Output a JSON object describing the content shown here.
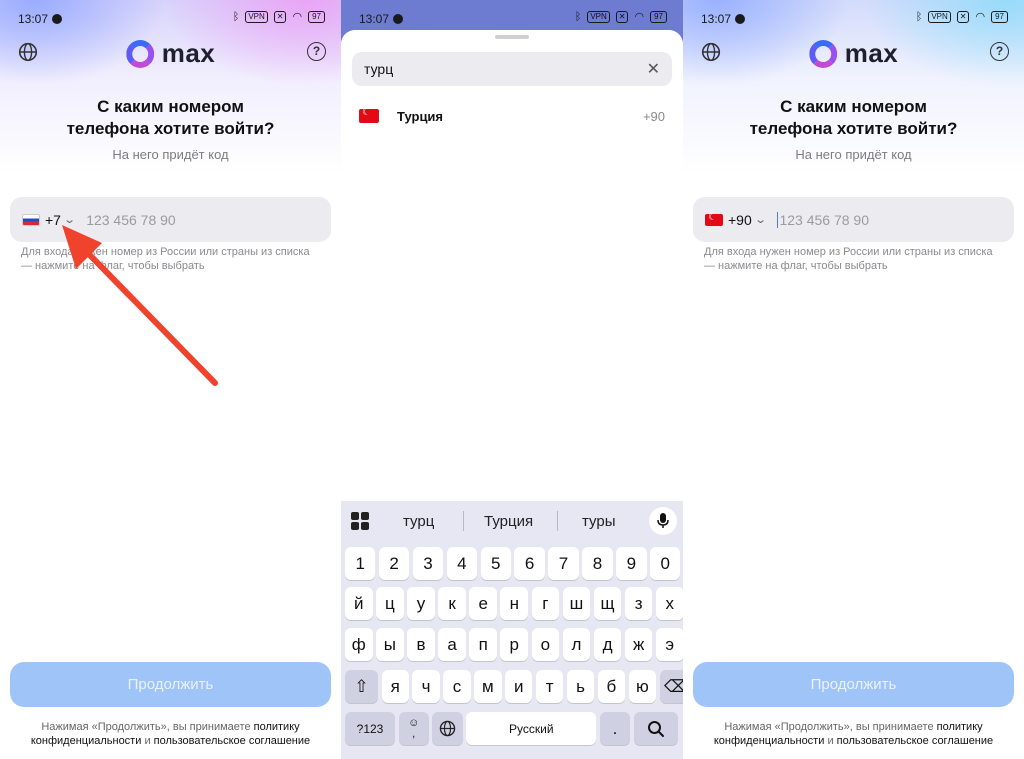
{
  "status_bar": {
    "time": "13:07",
    "vpn_label": "VPN",
    "battery_level": "97"
  },
  "app": {
    "logo_text": "max"
  },
  "login": {
    "headline_line1": "С каким номером",
    "headline_line2": "телефона хотите войти?",
    "subline": "На него придёт код",
    "phone_placeholder": "123 456 78 90",
    "hint": "Для входа нужен номер из России или страны из списка — нажмите на флаг, чтобы выбрать",
    "continue_label": "Продолжить",
    "terms_prefix": "Нажимая «Продолжить», вы принимаете",
    "terms_link1": "политику конфиденциальности",
    "terms_and": "и",
    "terms_link2": "пользовательское соглашение"
  },
  "screen1": {
    "country_code": "+7",
    "flag": "russia-flag"
  },
  "screen3": {
    "country_code": "+90",
    "flag": "turkey-flag"
  },
  "country_search": {
    "query": "турц",
    "results": [
      {
        "name": "Турция",
        "code": "+90",
        "flag": "turkey-flag"
      }
    ]
  },
  "keyboard": {
    "suggestions": [
      "турц",
      "Турция",
      "туры"
    ],
    "row_digits": [
      "1",
      "2",
      "3",
      "4",
      "5",
      "6",
      "7",
      "8",
      "9",
      "0"
    ],
    "row1": [
      "й",
      "ц",
      "у",
      "к",
      "е",
      "н",
      "г",
      "ш",
      "щ",
      "з",
      "х"
    ],
    "row2": [
      "ф",
      "ы",
      "в",
      "а",
      "п",
      "р",
      "о",
      "л",
      "д",
      "ж",
      "э"
    ],
    "row3": [
      "я",
      "ч",
      "с",
      "м",
      "и",
      "т",
      "ь",
      "б",
      "ю"
    ],
    "symbols_label": "?123",
    "comma_label": ",",
    "space_label": "Русский",
    "period_label": "."
  },
  "colors": {
    "continue_disabled": "#9fc4f8",
    "annotation_arrow": "#f0432e",
    "keyboard_bg": "#e6e7f2"
  }
}
